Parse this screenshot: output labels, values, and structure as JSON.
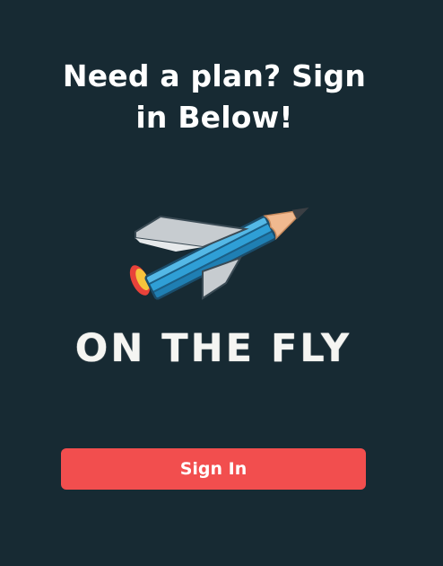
{
  "headline": {
    "line1": "Need a plan? Sign",
    "line2": "in Below!"
  },
  "logo": {
    "icon": "pencil-jet-icon",
    "text": "ON THE FLY"
  },
  "signin": {
    "label": "Sign In"
  },
  "colors": {
    "background": "#172a33",
    "button": "#f24e4e",
    "text": "#ffffff",
    "pencil_body": "#2f9fd6",
    "wing": "#c7ccd0",
    "tip_wood": "#f0b98f",
    "flame": "#e8423a"
  }
}
